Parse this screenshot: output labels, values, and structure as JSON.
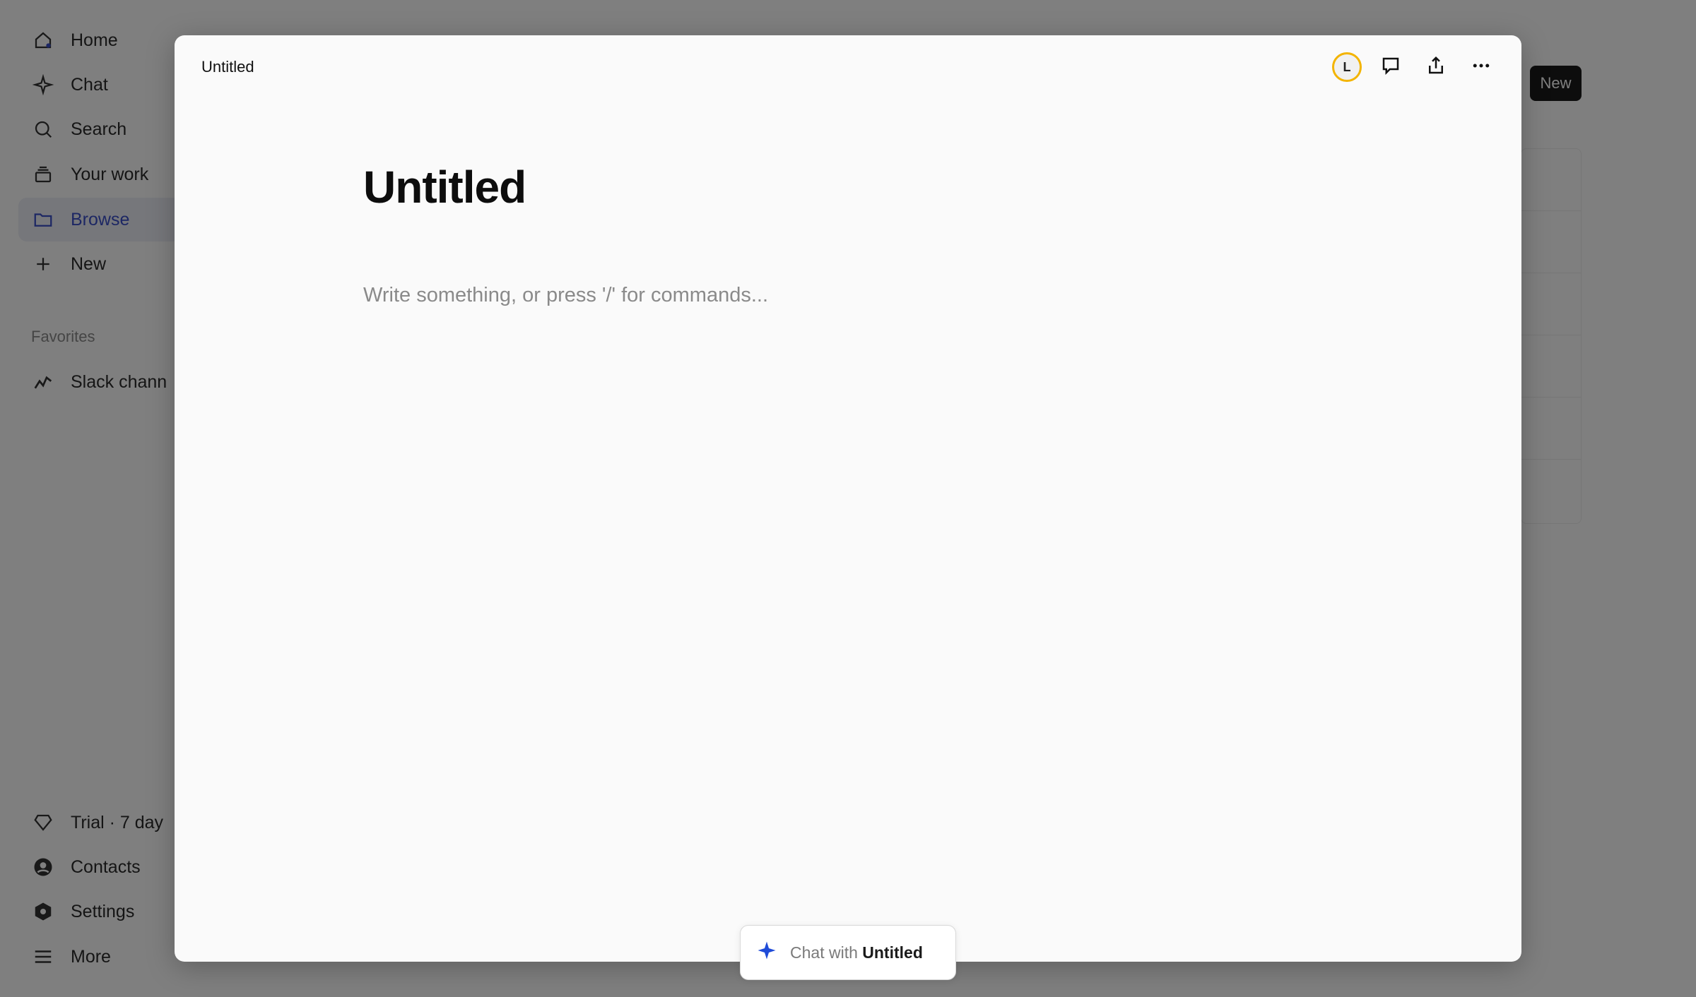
{
  "sidebar": {
    "items": [
      {
        "label": "Home",
        "icon": "home-icon"
      },
      {
        "label": "Chat",
        "icon": "sparkle-icon"
      },
      {
        "label": "Search",
        "icon": "search-icon"
      },
      {
        "label": "Your work",
        "icon": "stack-icon"
      },
      {
        "label": "Browse",
        "icon": "folder-icon",
        "active": true
      },
      {
        "label": "New",
        "icon": "plus-icon"
      }
    ],
    "favorites_header": "Favorites",
    "favorites": [
      {
        "label": "Slack chann",
        "icon": "trend-icon"
      }
    ],
    "bottom_items": [
      {
        "label": "Trial · 7 day",
        "icon": "diamond-icon"
      },
      {
        "label": "Contacts",
        "icon": "person-icon"
      },
      {
        "label": "Settings",
        "icon": "hexagon-gear-icon"
      },
      {
        "label": "More",
        "icon": "menu-icon"
      }
    ]
  },
  "background": {
    "new_button": "New"
  },
  "modal": {
    "breadcrumb_title": "Untitled",
    "avatar_initial": "L",
    "doc_title": "Untitled",
    "placeholder": "Write something, or press '/' for commands...",
    "chat_prefix": "Chat with",
    "chat_target": "Untitled"
  },
  "colors": {
    "accent": "#3a4fc8",
    "avatar_ring": "#f3b400",
    "sparkle": "#1f4bd8"
  }
}
